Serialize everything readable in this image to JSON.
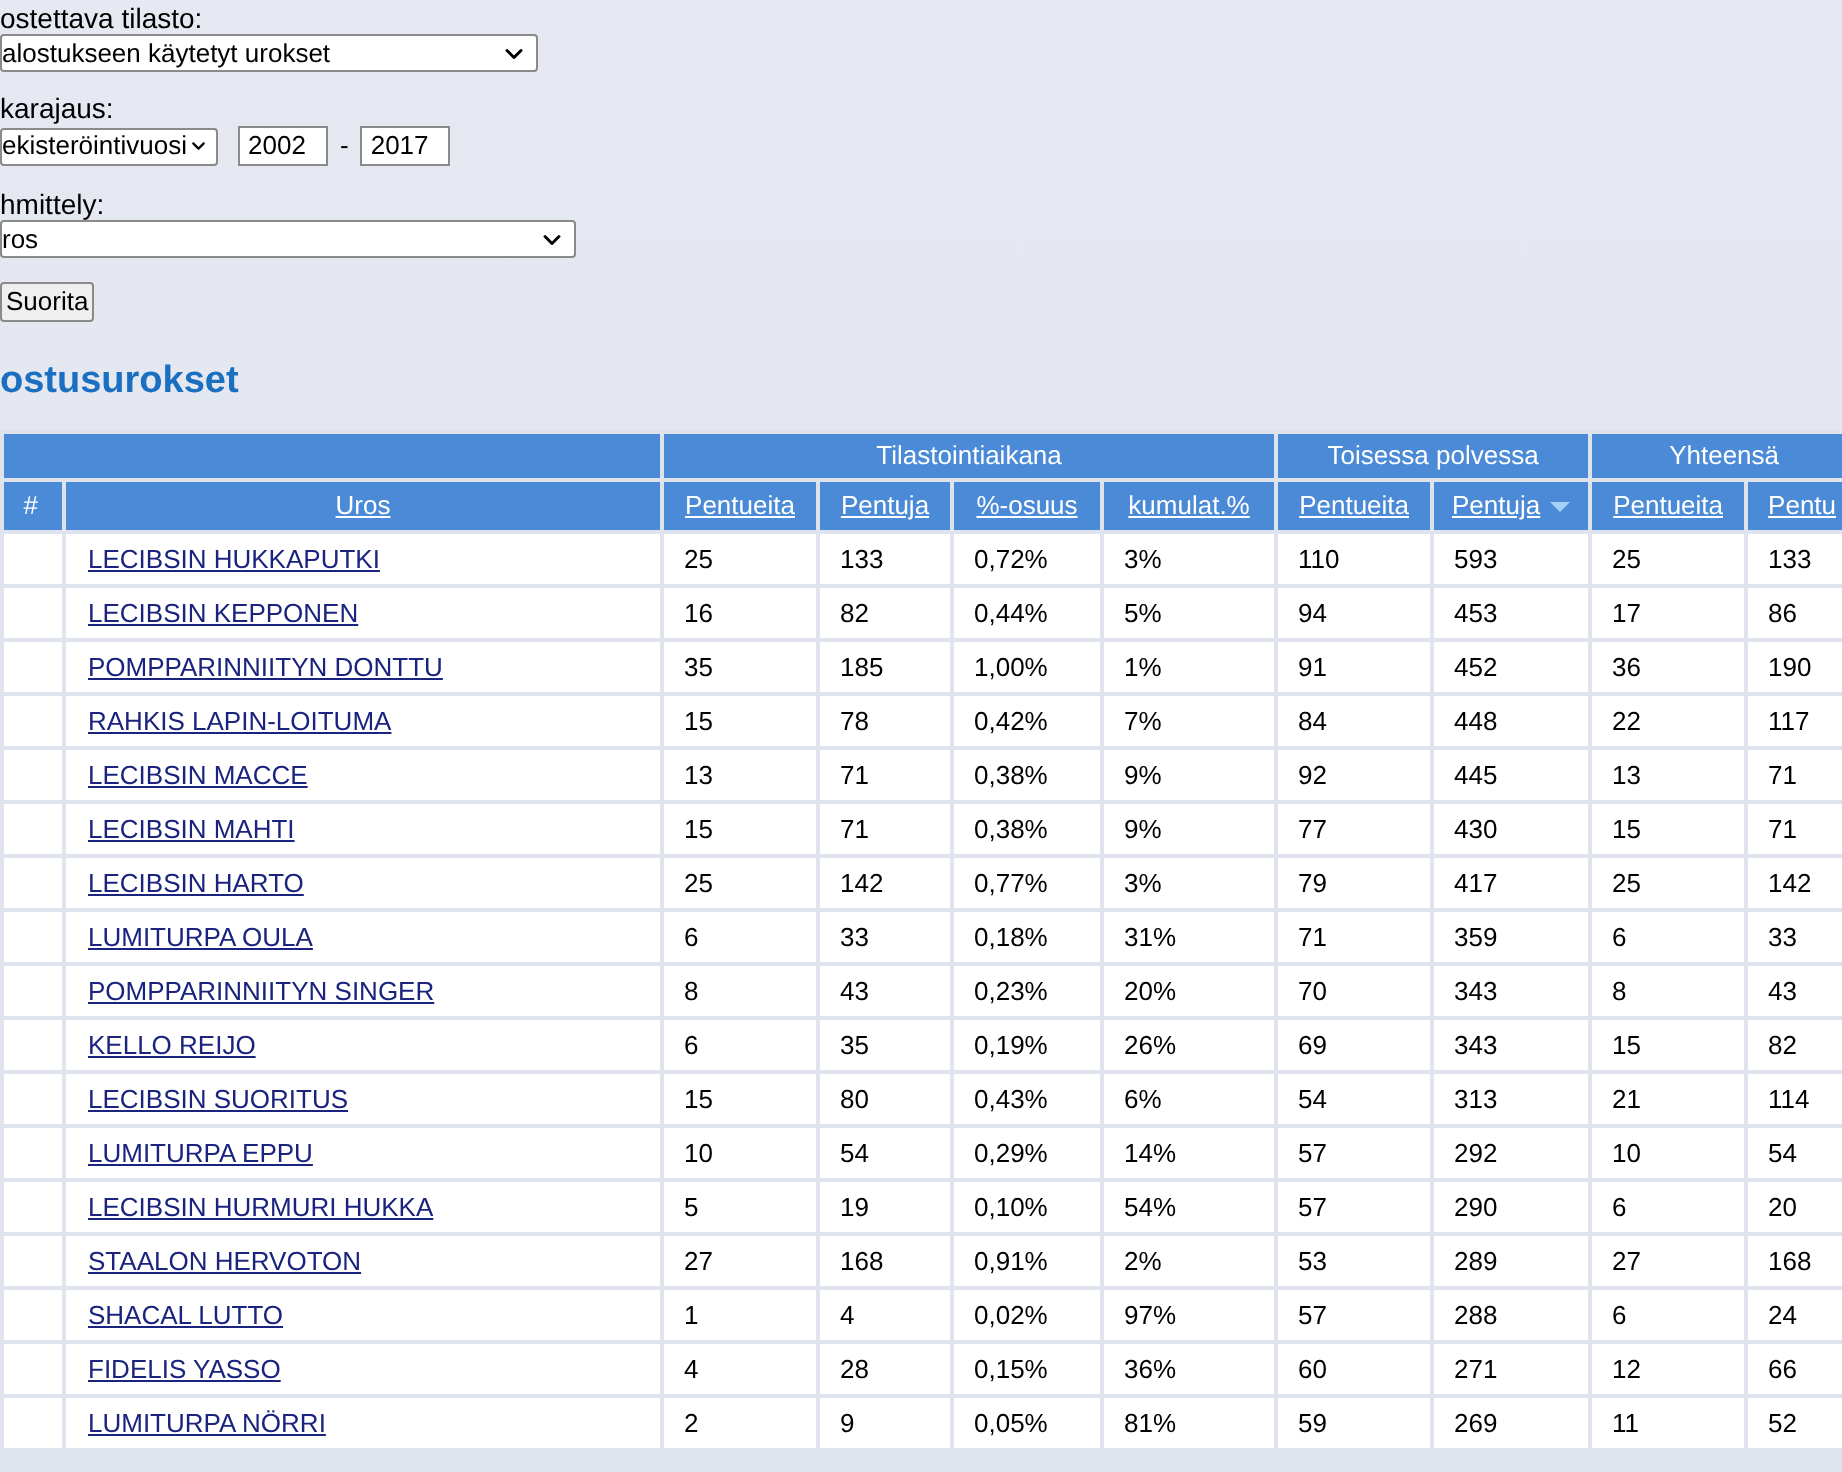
{
  "statistic": {
    "label": "ostettava tilasto:",
    "value": "alostukseen käytetyt urokset"
  },
  "period": {
    "label": "karajaus:",
    "basis": "ekisteröintivuosi",
    "from": "2002",
    "separator": "-",
    "to": "2017"
  },
  "grouping": {
    "label": "hmittely:",
    "value": "ros"
  },
  "run_button": "Suorita",
  "heading": "ostusurokset",
  "table": {
    "groups": [
      {
        "columns": [
          {
            "label": "#",
            "link": false,
            "sorted": false
          },
          {
            "label": "Uros",
            "link": true,
            "sorted": false
          }
        ]
      },
      {
        "label": "Tilastointiaikana",
        "columns": [
          {
            "label": "Pentueita",
            "link": true,
            "sorted": false
          },
          {
            "label": "Pentuja",
            "link": true,
            "sorted": false
          },
          {
            "label": "%-osuus",
            "link": true,
            "sorted": false
          },
          {
            "label": "kumulat.%",
            "link": true,
            "sorted": false
          }
        ]
      },
      {
        "label": "Toisessa polvessa",
        "columns": [
          {
            "label": "Pentueita",
            "link": true,
            "sorted": false
          },
          {
            "label": "Pentuja",
            "link": true,
            "sorted": true
          }
        ]
      },
      {
        "label": "Yhteensä",
        "columns": [
          {
            "label": "Pentueita",
            "link": true,
            "sorted": false
          },
          {
            "label": "Pentu",
            "link": true,
            "sorted": false
          }
        ]
      }
    ],
    "rows": [
      {
        "name": "LECIBSIN HUKKAPUTKI",
        "cells": [
          "25",
          "133",
          "0,72%",
          "3%",
          "110",
          "593",
          "25",
          "133"
        ]
      },
      {
        "name": "LECIBSIN KEPPONEN",
        "cells": [
          "16",
          "82",
          "0,44%",
          "5%",
          "94",
          "453",
          "17",
          "86"
        ]
      },
      {
        "name": "POMPPARINNIITYN DONTTU",
        "cells": [
          "35",
          "185",
          "1,00%",
          "1%",
          "91",
          "452",
          "36",
          "190"
        ]
      },
      {
        "name": "RAHKIS LAPIN-LOITUMA",
        "cells": [
          "15",
          "78",
          "0,42%",
          "7%",
          "84",
          "448",
          "22",
          "117"
        ]
      },
      {
        "name": "LECIBSIN MACCE",
        "cells": [
          "13",
          "71",
          "0,38%",
          "9%",
          "92",
          "445",
          "13",
          "71"
        ]
      },
      {
        "name": "LECIBSIN MAHTI",
        "cells": [
          "15",
          "71",
          "0,38%",
          "9%",
          "77",
          "430",
          "15",
          "71"
        ]
      },
      {
        "name": "LECIBSIN HARTO",
        "cells": [
          "25",
          "142",
          "0,77%",
          "3%",
          "79",
          "417",
          "25",
          "142"
        ]
      },
      {
        "name": "LUMITURPA OULA",
        "cells": [
          "6",
          "33",
          "0,18%",
          "31%",
          "71",
          "359",
          "6",
          "33"
        ]
      },
      {
        "name": "POMPPARINNIITYN SINGER",
        "cells": [
          "8",
          "43",
          "0,23%",
          "20%",
          "70",
          "343",
          "8",
          "43"
        ]
      },
      {
        "name": "KELLO REIJO",
        "cells": [
          "6",
          "35",
          "0,19%",
          "26%",
          "69",
          "343",
          "15",
          "82"
        ]
      },
      {
        "name": "LECIBSIN SUORITUS",
        "cells": [
          "15",
          "80",
          "0,43%",
          "6%",
          "54",
          "313",
          "21",
          "114"
        ]
      },
      {
        "name": "LUMITURPA EPPU",
        "cells": [
          "10",
          "54",
          "0,29%",
          "14%",
          "57",
          "292",
          "10",
          "54"
        ]
      },
      {
        "name": "LECIBSIN HURMURI HUKKA",
        "cells": [
          "5",
          "19",
          "0,10%",
          "54%",
          "57",
          "290",
          "6",
          "20"
        ]
      },
      {
        "name": "STAALON HERVOTON",
        "cells": [
          "27",
          "168",
          "0,91%",
          "2%",
          "53",
          "289",
          "27",
          "168"
        ]
      },
      {
        "name": "SHACAL LUTTO",
        "cells": [
          "1",
          "4",
          "0,02%",
          "97%",
          "57",
          "288",
          "6",
          "24"
        ]
      },
      {
        "name": "FIDELIS YASSO",
        "cells": [
          "4",
          "28",
          "0,15%",
          "36%",
          "60",
          "271",
          "12",
          "66"
        ]
      },
      {
        "name": "LUMITURPA NÖRRI",
        "cells": [
          "2",
          "9",
          "0,05%",
          "81%",
          "59",
          "269",
          "11",
          "52"
        ]
      }
    ]
  }
}
